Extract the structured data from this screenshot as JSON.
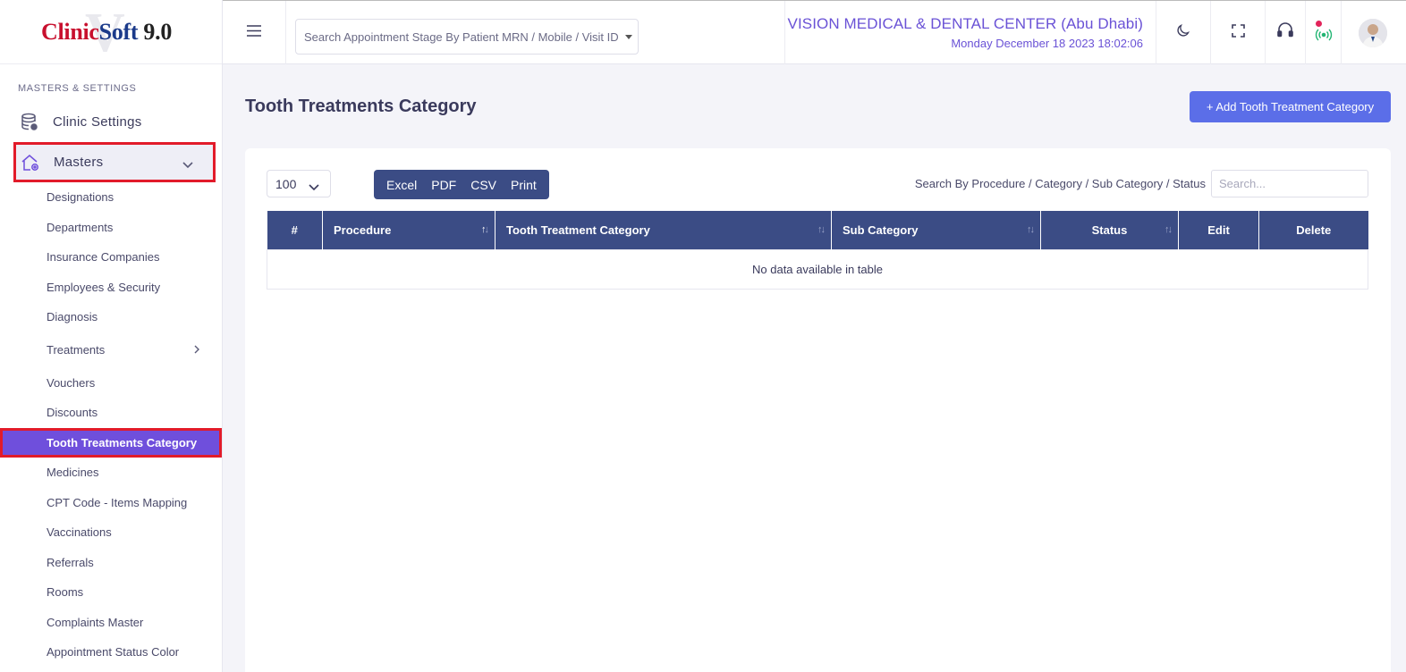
{
  "logo": {
    "part1": "Clinic",
    "part2": "Soft",
    "version": " 9.0",
    "watermark": "V"
  },
  "sidebar": {
    "section_title": "MASTERS & SETTINGS",
    "clinic_settings": "Clinic Settings",
    "masters": "Masters",
    "items": [
      "Designations",
      "Departments",
      "Insurance Companies",
      "Employees & Security",
      "Diagnosis",
      "Treatments",
      "Vouchers",
      "Discounts",
      "Tooth Treatments Category",
      "Medicines",
      "CPT Code - Items Mapping",
      "Vaccinations",
      "Referrals",
      "Rooms",
      "Complaints Master",
      "Appointment Status Color"
    ]
  },
  "topbar": {
    "search_placeholder": "Search Appointment Stage By Patient MRN / Mobile / Visit ID",
    "clinic_name": "VISION MEDICAL & DENTAL CENTER (Abu Dhabi)",
    "datetime": "Monday December 18 2023 18:02:06"
  },
  "page": {
    "title": "Tooth Treatments Category",
    "add_button": "+ Add Tooth Treatment Category"
  },
  "table_controls": {
    "page_length": "100",
    "export_buttons": [
      "Excel",
      "PDF",
      "CSV",
      "Print"
    ],
    "filter_label": "Search By Procedure / Category / Sub Category / Status",
    "filter_placeholder": "Search..."
  },
  "table": {
    "columns": [
      "#",
      "Procedure",
      "Tooth Treatment Category",
      "Sub Category",
      "Status",
      "Edit",
      "Delete"
    ],
    "empty_message": "No data available in table"
  },
  "colors": {
    "accent": "#6f4fdc",
    "header_bg": "#3b4c85",
    "primary_button": "#5b6ee8",
    "highlight_border": "#e21b2a"
  }
}
